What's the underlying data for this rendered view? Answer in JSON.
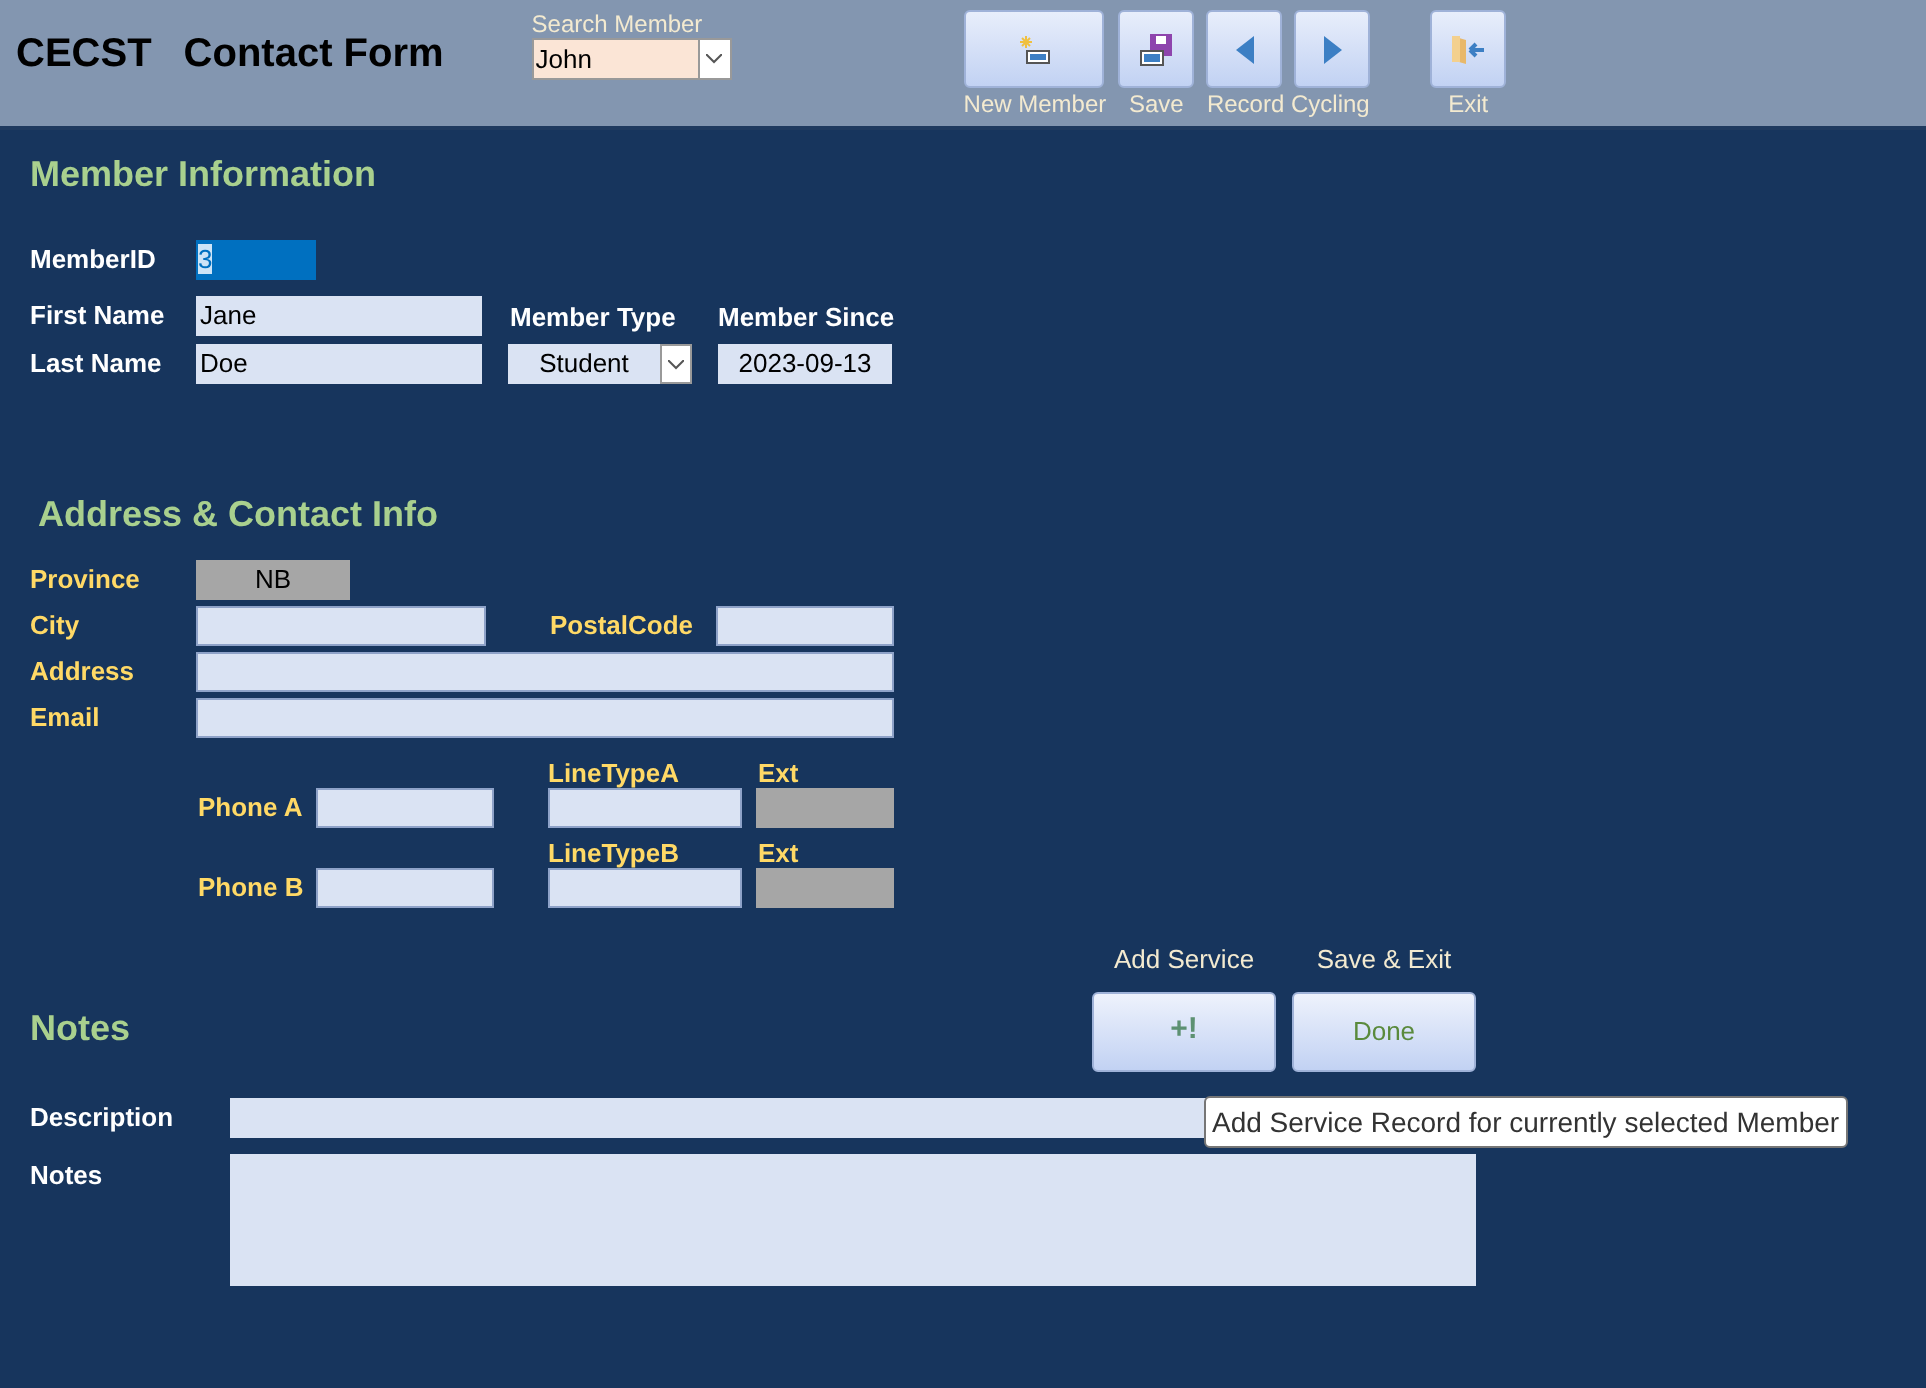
{
  "header": {
    "app_name": "CECST",
    "title": "Contact Form",
    "search": {
      "label": "Search Member",
      "value": "John"
    },
    "toolbar": [
      {
        "label": "New Member",
        "buttons": [
          {
            "kind": "new"
          }
        ]
      },
      {
        "label": "Save",
        "buttons": [
          {
            "kind": "save"
          }
        ]
      },
      {
        "label": "Record Cycling",
        "buttons": [
          {
            "kind": "prev"
          },
          {
            "kind": "next"
          }
        ]
      },
      {
        "label": "Exit",
        "buttons": [
          {
            "kind": "exit"
          }
        ]
      }
    ]
  },
  "member_info": {
    "heading": "Member Information",
    "member_id": {
      "label": "MemberID",
      "value": "3",
      "focused": true
    },
    "first_name": {
      "label": "First Name",
      "value": "Jane"
    },
    "last_name": {
      "label": "Last Name",
      "value": "Doe"
    },
    "member_type": {
      "label": "Member Type",
      "value": "Student"
    },
    "member_since": {
      "label": "Member Since",
      "value": "2023-09-13"
    }
  },
  "address": {
    "heading": "Address & Contact Info",
    "province": {
      "label": "Province",
      "value": "NB",
      "disabled": true
    },
    "city": {
      "label": "City",
      "disabled": false
    },
    "postal_code": {
      "label": "PostalCode",
      "disabled": false
    },
    "address": {
      "label": "Address",
      "disabled": false
    },
    "email": {
      "label": "Email",
      "disabled": false
    },
    "phones": [
      {
        "label": "Phone A",
        "line_type_label": "LineTypeA",
        "ext_label": "Ext",
        "ext_disabled": true
      },
      {
        "label": "Phone B",
        "line_type_label": "LineTypeB",
        "ext_label": "Ext",
        "ext_disabled": true
      }
    ]
  },
  "actions": [
    {
      "label": "Add Service",
      "kind": "icon",
      "button": "+!"
    },
    {
      "label": "Save & Exit",
      "kind": "text",
      "button": "Done"
    }
  ],
  "tooltip": "Add Service Record for currently selected Member",
  "notes": {
    "heading": "Notes",
    "description": {
      "label": "Description"
    },
    "notes": {
      "label": "Notes"
    }
  }
}
